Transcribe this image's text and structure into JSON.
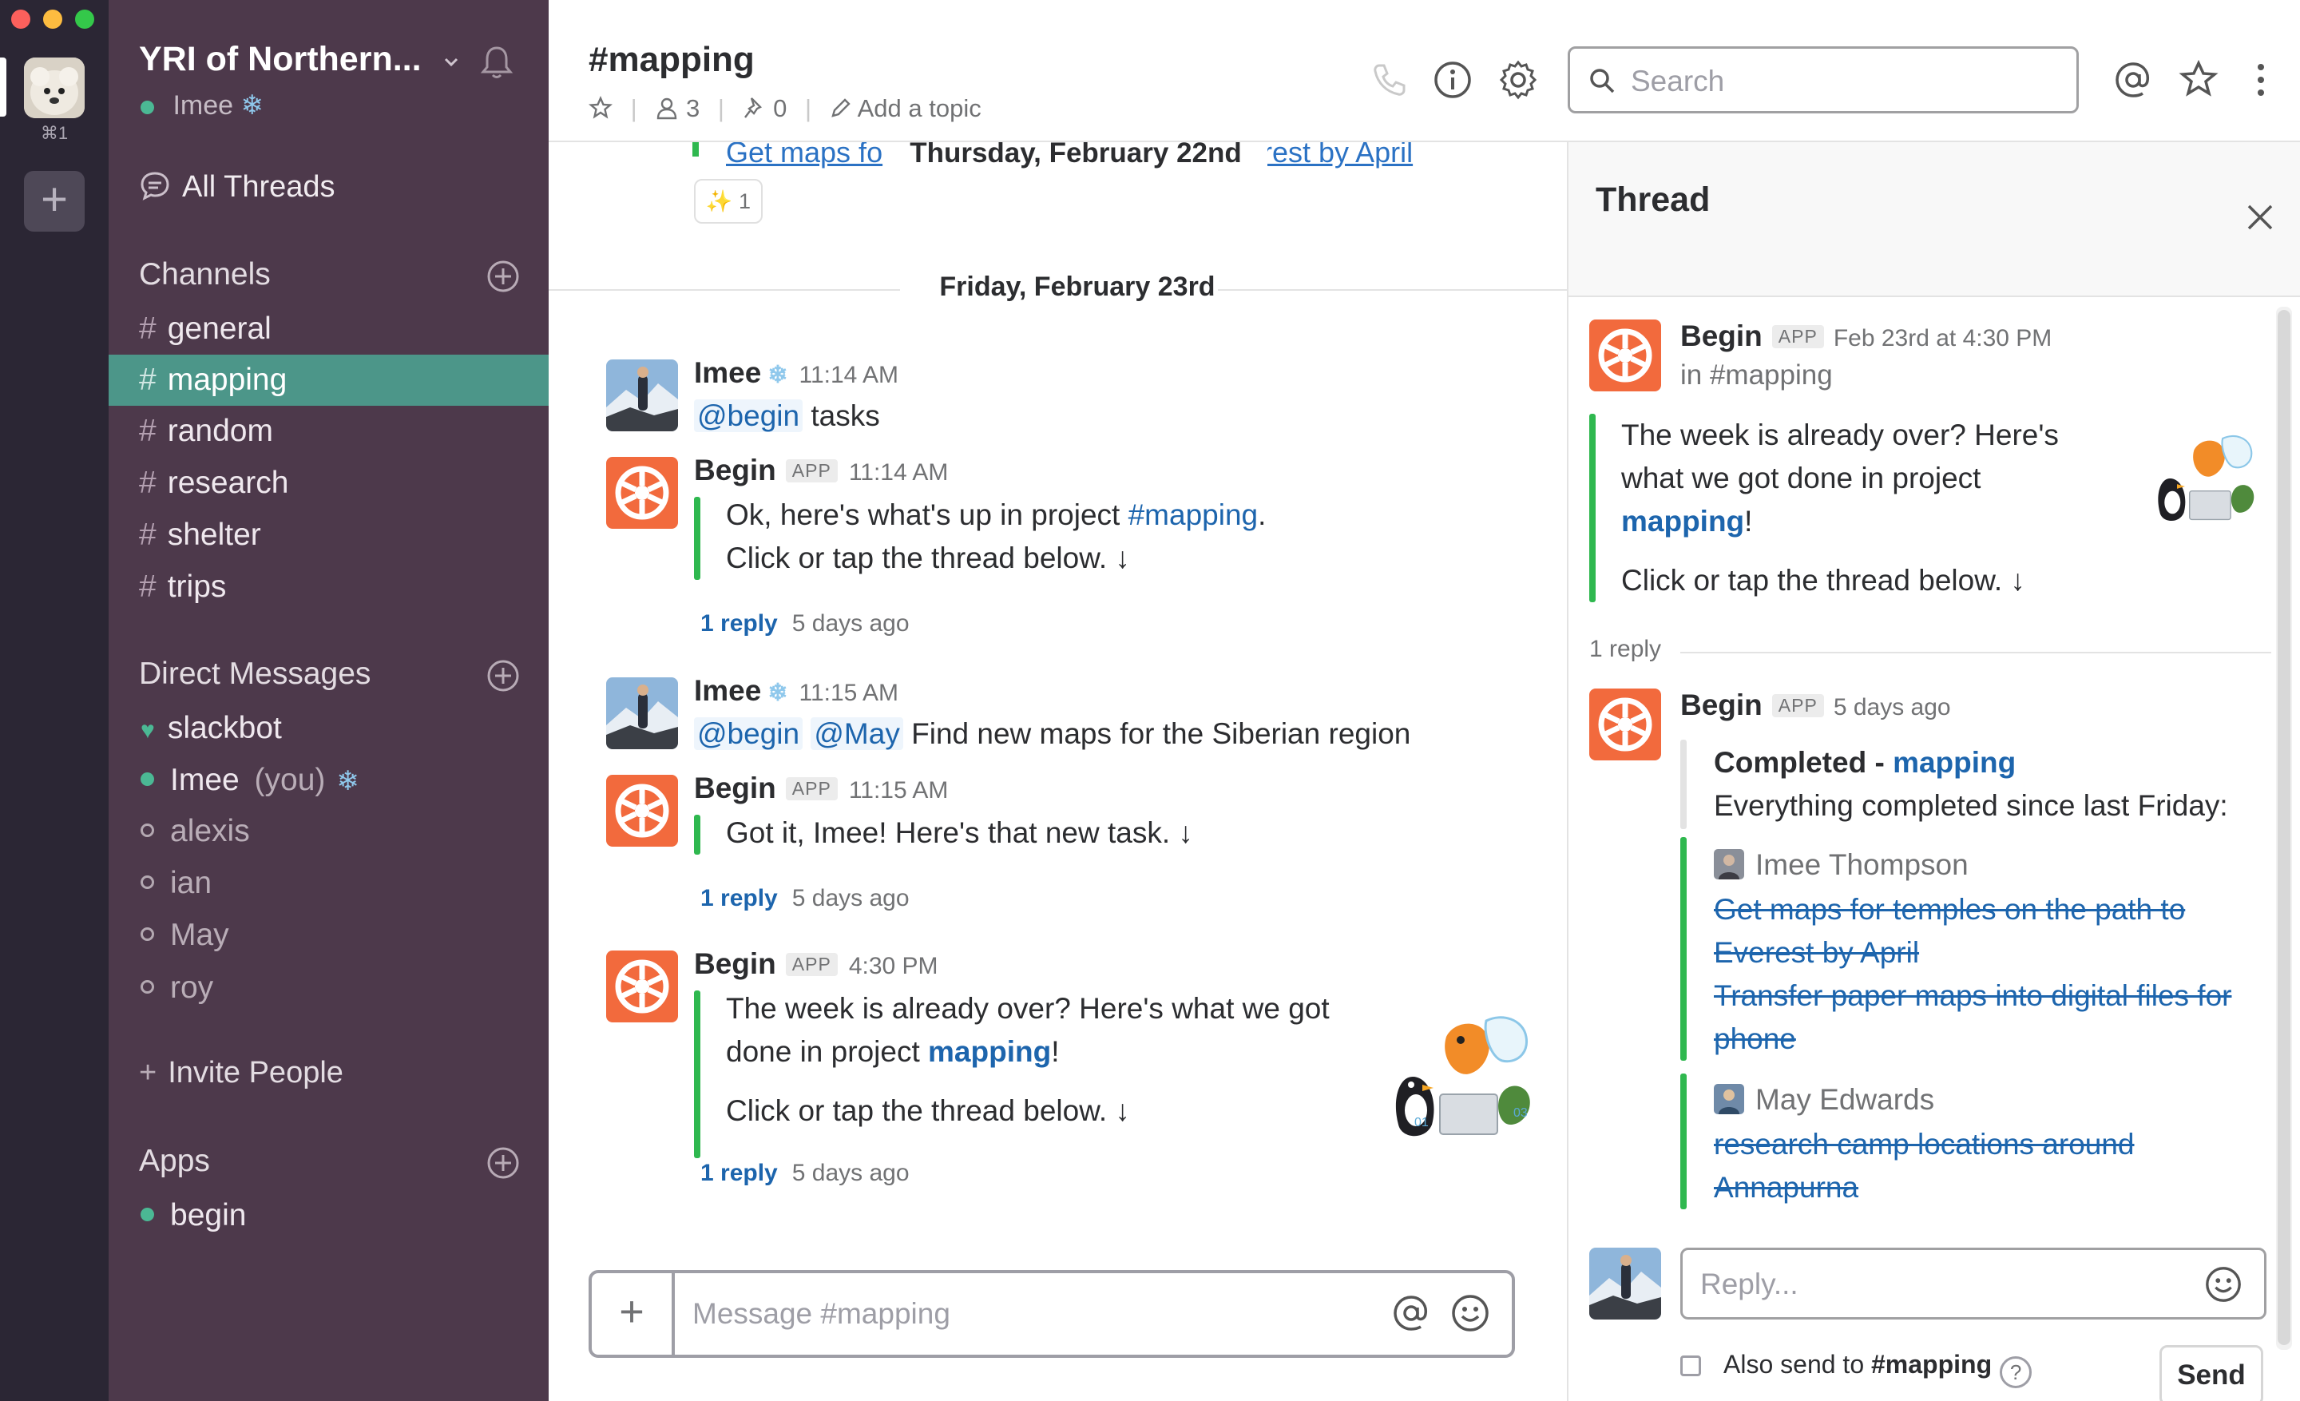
{
  "workspace_switcher": {
    "shortcut": "⌘1",
    "add_label": "+"
  },
  "sidebar": {
    "team_name": "YRI of Northern...",
    "user_name": "Imee",
    "all_threads": "All Threads",
    "channels_header": "Channels",
    "channels": [
      "general",
      "mapping",
      "random",
      "research",
      "shelter",
      "trips"
    ],
    "active_channel": "mapping",
    "dm_header": "Direct Messages",
    "dms": [
      {
        "name": "slackbot",
        "status": "bot"
      },
      {
        "name": "Imee",
        "suffix": "(you)",
        "status": "online"
      },
      {
        "name": "alexis",
        "status": "away"
      },
      {
        "name": "ian",
        "status": "away"
      },
      {
        "name": "May",
        "status": "away"
      },
      {
        "name": "roy",
        "status": "away"
      }
    ],
    "invite": "Invite People",
    "apps_header": "Apps",
    "apps": [
      "begin"
    ]
  },
  "header": {
    "channel_title": "#mapping",
    "member_count": "3",
    "pinned_count": "0",
    "add_topic": "Add a topic",
    "search_placeholder": "Search"
  },
  "messages": {
    "previous_fragment_left": "Get maps fo",
    "previous_fragment_right": "verest by April",
    "floating_date": "Thursday, February 22nd",
    "reaction_emoji": "✨",
    "reaction_count": "1",
    "day_divider": "Friday, February 23rd",
    "items": [
      {
        "author": "Imee",
        "time": "11:14 AM",
        "mention": "@begin",
        "text": "tasks"
      },
      {
        "author": "Begin",
        "badge": "APP",
        "time": "11:14 AM",
        "line1_prefix": "Ok, here's what's up in project ",
        "line1_link": "#mapping",
        "line1_suffix": ".",
        "line2": "Click or tap the thread below. ↓",
        "reply_count": "1 reply",
        "reply_ago": "5 days ago"
      },
      {
        "author": "Imee",
        "time": "11:15 AM",
        "mention1": "@begin",
        "mention2": "@May",
        "text": "Find new maps for the Siberian region"
      },
      {
        "author": "Begin",
        "badge": "APP",
        "time": "11:15 AM",
        "line1": "Got it, Imee! Here's that new task. ↓",
        "reply_count": "1 reply",
        "reply_ago": "5 days ago"
      },
      {
        "author": "Begin",
        "badge": "APP",
        "time": "4:30 PM",
        "line1": "The week is already over? Here's what we got",
        "line2_prefix": "done in project ",
        "line2_link": "mapping",
        "line2_suffix": "!",
        "line3": "Click or tap the thread below. ↓",
        "reply_count": "1 reply",
        "reply_ago": "5 days ago"
      }
    ],
    "composer_placeholder": "Message #mapping"
  },
  "thread": {
    "title": "Thread",
    "parent": {
      "author": "Begin",
      "badge": "APP",
      "time": "Feb 23rd at 4:30 PM",
      "channel": "in #mapping",
      "line1": "The week is already over? Here's",
      "line2": "what we got done in project",
      "line3_link": "mapping",
      "line3_suffix": "!",
      "line4": "Click or tap the thread below. ↓"
    },
    "reply_count": "1 reply",
    "reply": {
      "author": "Begin",
      "badge": "APP",
      "time": "5 days ago",
      "completed_label": "Completed -",
      "completed_link": "mapping",
      "summary": "Everything completed since last Friday:",
      "groups": [
        {
          "assignee": "Imee Thompson",
          "tasks": [
            "Get maps for temples on the path to",
            "Everest by April",
            "Transfer paper maps into digital files for",
            "phone"
          ]
        },
        {
          "assignee": "May Edwards",
          "tasks": [
            "research camp locations around",
            "Annapurna"
          ]
        }
      ]
    },
    "reply_placeholder": "Reply...",
    "also_send_prefix": "Also send to ",
    "also_send_channel": "#mapping",
    "help_glyph": "?",
    "send_label": "Send"
  },
  "colors": {
    "sidebar_bg": "#4d394b",
    "switcher_bg": "#2b2634",
    "active_channel_bg": "#4c9689",
    "link": "#1d65ad",
    "attachment_bar": "#2fb84f",
    "begin_orange": "#f26a3d"
  },
  "icons": [
    "bell-icon",
    "threads-icon",
    "plus-circle-icon",
    "star-icon",
    "person-icon",
    "pin-icon",
    "pencil-icon",
    "phone-icon",
    "info-icon",
    "gear-icon",
    "search-icon",
    "at-icon",
    "star-icon",
    "more-vertical-icon",
    "close-icon",
    "emoji-icon",
    "begin-logo-icon"
  ]
}
